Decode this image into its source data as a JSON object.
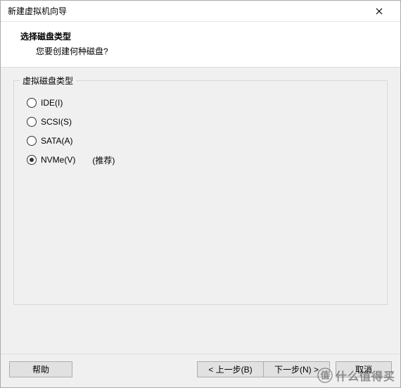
{
  "window": {
    "title": "新建虚拟机向导"
  },
  "header": {
    "title": "选择磁盘类型",
    "subtitle": "您要创建何种磁盘?"
  },
  "fieldset": {
    "legend": "虚拟磁盘类型",
    "options": [
      {
        "label": "IDE(I)",
        "hint": "",
        "selected": false
      },
      {
        "label": "SCSI(S)",
        "hint": "",
        "selected": false
      },
      {
        "label": "SATA(A)",
        "hint": "",
        "selected": false
      },
      {
        "label": "NVMe(V)",
        "hint": "(推荐)",
        "selected": true
      }
    ]
  },
  "buttons": {
    "help": "帮助",
    "back": "< 上一步(B)",
    "next": "下一步(N) >",
    "cancel": "取消"
  },
  "watermark": {
    "text": "什么值得买"
  }
}
